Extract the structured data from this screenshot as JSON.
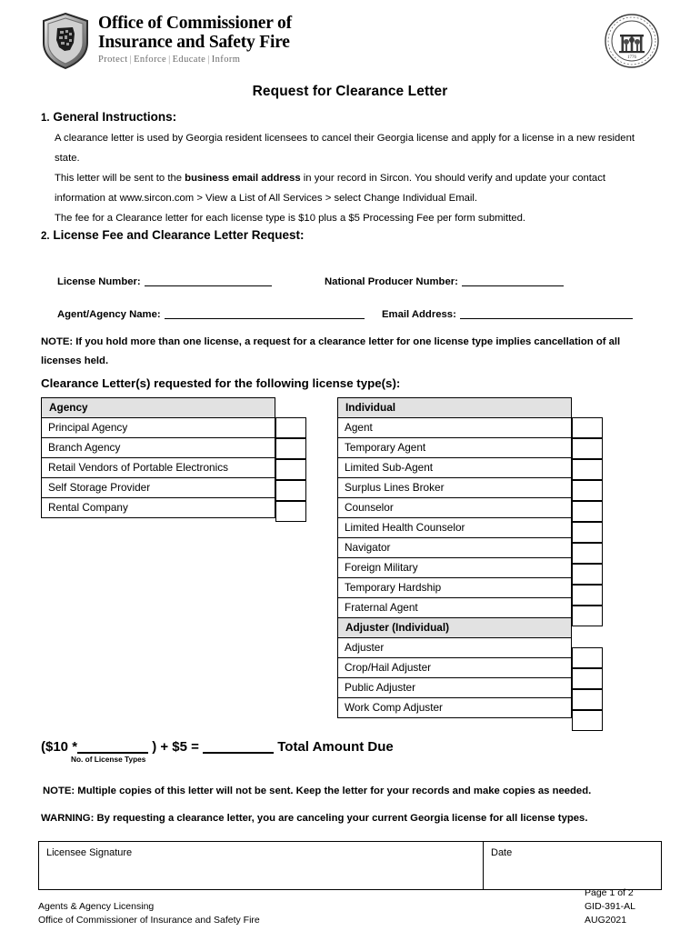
{
  "header": {
    "agency_line1": "Office of Commissioner of",
    "agency_line2": "Insurance and Safety Fire",
    "tagline_items": [
      "Protect",
      "Enforce",
      "Educate",
      "Inform"
    ],
    "shield_icon": "georgia-shield-icon",
    "seal_icon": "georgia-state-seal-icon"
  },
  "title": "Request for Clearance Letter",
  "section1": {
    "number": "1.",
    "heading": "General Instructions:",
    "para1": "A clearance letter is used by Georgia resident licensees to cancel their Georgia license and apply for a license in a new resident state.",
    "para2_before": "This letter will be sent to the ",
    "para2_bold": "business email address",
    "para2_after": " in your record in Sircon. You should verify and update your contact information at www.sircon.com > View a List of All Services > select Change Individual Email.",
    "para3": "The fee for a Clearance letter for each license type is $10 plus a $5 Processing Fee per form submitted."
  },
  "section2": {
    "number": "2.",
    "heading": "License Fee and Clearance Letter Request:",
    "fields": {
      "license_number_label": "License Number:",
      "license_number_value": "",
      "npn_label": "National Producer Number:",
      "npn_value": "",
      "agent_agency_name_label": "Agent/Agency Name:",
      "agent_agency_name_value": "",
      "email_label": "Email Address:",
      "email_value": ""
    },
    "note": "NOTE: If you hold more than one license, a request for a clearance letter for one license type implies cancellation of all licenses held."
  },
  "tables_heading": "Clearance Letter(s) requested for the following license type(s):",
  "agency_table": {
    "header": "Agency",
    "rows": [
      "Principal Agency",
      "Branch Agency",
      "Retail Vendors of Portable Electronics",
      "Self Storage Provider",
      "Rental Company"
    ]
  },
  "individual_table": {
    "header": "Individual",
    "rows": [
      "Agent",
      "Temporary Agent",
      "Limited Sub-Agent",
      "Surplus Lines Broker",
      "Counselor",
      "Limited Health Counselor",
      "Navigator",
      "Foreign Military",
      "Temporary Hardship",
      "Fraternal Agent"
    ],
    "subheader": "Adjuster (Individual)",
    "adjuster_rows": [
      "Adjuster",
      "Crop/Hail Adjuster",
      "Public Adjuster",
      "Work Comp Adjuster"
    ]
  },
  "fee": {
    "prefix": "($10 *",
    "count_value": "",
    "middle": ") + $5 =",
    "total_value": "",
    "suffix": "Total Amount Due",
    "caption": "No. of License Types"
  },
  "note_multiple": "NOTE: Multiple copies of this letter will not be sent. Keep the letter for your records and make copies as needed.",
  "warning": "WARNING: By requesting a clearance letter, you are canceling your current Georgia license for all license types.",
  "signature": {
    "signature_label": "Licensee Signature",
    "signature_value": "",
    "date_label": "Date",
    "date_value": ""
  },
  "footer": {
    "left_line1": "Agents & Agency Licensing",
    "left_line2": "Office of Commissioner of Insurance and Safety Fire",
    "page": "Page 1 of 2",
    "form_id": "GID-391-AL",
    "revision": "AUG2021"
  },
  "colors": {
    "table_header_bg": "#e2e2e2",
    "text": "#000000",
    "tagline": "#6b6b6b"
  }
}
